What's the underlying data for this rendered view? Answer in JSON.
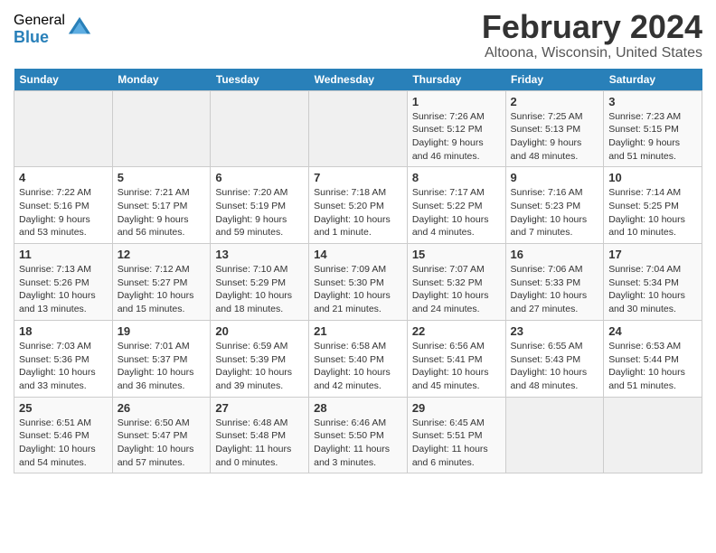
{
  "logo": {
    "general": "General",
    "blue": "Blue"
  },
  "header": {
    "month": "February 2024",
    "location": "Altoona, Wisconsin, United States"
  },
  "weekdays": [
    "Sunday",
    "Monday",
    "Tuesday",
    "Wednesday",
    "Thursday",
    "Friday",
    "Saturday"
  ],
  "weeks": [
    [
      {
        "day": "",
        "info": ""
      },
      {
        "day": "",
        "info": ""
      },
      {
        "day": "",
        "info": ""
      },
      {
        "day": "",
        "info": ""
      },
      {
        "day": "1",
        "info": "Sunrise: 7:26 AM\nSunset: 5:12 PM\nDaylight: 9 hours\nand 46 minutes."
      },
      {
        "day": "2",
        "info": "Sunrise: 7:25 AM\nSunset: 5:13 PM\nDaylight: 9 hours\nand 48 minutes."
      },
      {
        "day": "3",
        "info": "Sunrise: 7:23 AM\nSunset: 5:15 PM\nDaylight: 9 hours\nand 51 minutes."
      }
    ],
    [
      {
        "day": "4",
        "info": "Sunrise: 7:22 AM\nSunset: 5:16 PM\nDaylight: 9 hours\nand 53 minutes."
      },
      {
        "day": "5",
        "info": "Sunrise: 7:21 AM\nSunset: 5:17 PM\nDaylight: 9 hours\nand 56 minutes."
      },
      {
        "day": "6",
        "info": "Sunrise: 7:20 AM\nSunset: 5:19 PM\nDaylight: 9 hours\nand 59 minutes."
      },
      {
        "day": "7",
        "info": "Sunrise: 7:18 AM\nSunset: 5:20 PM\nDaylight: 10 hours\nand 1 minute."
      },
      {
        "day": "8",
        "info": "Sunrise: 7:17 AM\nSunset: 5:22 PM\nDaylight: 10 hours\nand 4 minutes."
      },
      {
        "day": "9",
        "info": "Sunrise: 7:16 AM\nSunset: 5:23 PM\nDaylight: 10 hours\nand 7 minutes."
      },
      {
        "day": "10",
        "info": "Sunrise: 7:14 AM\nSunset: 5:25 PM\nDaylight: 10 hours\nand 10 minutes."
      }
    ],
    [
      {
        "day": "11",
        "info": "Sunrise: 7:13 AM\nSunset: 5:26 PM\nDaylight: 10 hours\nand 13 minutes."
      },
      {
        "day": "12",
        "info": "Sunrise: 7:12 AM\nSunset: 5:27 PM\nDaylight: 10 hours\nand 15 minutes."
      },
      {
        "day": "13",
        "info": "Sunrise: 7:10 AM\nSunset: 5:29 PM\nDaylight: 10 hours\nand 18 minutes."
      },
      {
        "day": "14",
        "info": "Sunrise: 7:09 AM\nSunset: 5:30 PM\nDaylight: 10 hours\nand 21 minutes."
      },
      {
        "day": "15",
        "info": "Sunrise: 7:07 AM\nSunset: 5:32 PM\nDaylight: 10 hours\nand 24 minutes."
      },
      {
        "day": "16",
        "info": "Sunrise: 7:06 AM\nSunset: 5:33 PM\nDaylight: 10 hours\nand 27 minutes."
      },
      {
        "day": "17",
        "info": "Sunrise: 7:04 AM\nSunset: 5:34 PM\nDaylight: 10 hours\nand 30 minutes."
      }
    ],
    [
      {
        "day": "18",
        "info": "Sunrise: 7:03 AM\nSunset: 5:36 PM\nDaylight: 10 hours\nand 33 minutes."
      },
      {
        "day": "19",
        "info": "Sunrise: 7:01 AM\nSunset: 5:37 PM\nDaylight: 10 hours\nand 36 minutes."
      },
      {
        "day": "20",
        "info": "Sunrise: 6:59 AM\nSunset: 5:39 PM\nDaylight: 10 hours\nand 39 minutes."
      },
      {
        "day": "21",
        "info": "Sunrise: 6:58 AM\nSunset: 5:40 PM\nDaylight: 10 hours\nand 42 minutes."
      },
      {
        "day": "22",
        "info": "Sunrise: 6:56 AM\nSunset: 5:41 PM\nDaylight: 10 hours\nand 45 minutes."
      },
      {
        "day": "23",
        "info": "Sunrise: 6:55 AM\nSunset: 5:43 PM\nDaylight: 10 hours\nand 48 minutes."
      },
      {
        "day": "24",
        "info": "Sunrise: 6:53 AM\nSunset: 5:44 PM\nDaylight: 10 hours\nand 51 minutes."
      }
    ],
    [
      {
        "day": "25",
        "info": "Sunrise: 6:51 AM\nSunset: 5:46 PM\nDaylight: 10 hours\nand 54 minutes."
      },
      {
        "day": "26",
        "info": "Sunrise: 6:50 AM\nSunset: 5:47 PM\nDaylight: 10 hours\nand 57 minutes."
      },
      {
        "day": "27",
        "info": "Sunrise: 6:48 AM\nSunset: 5:48 PM\nDaylight: 11 hours\nand 0 minutes."
      },
      {
        "day": "28",
        "info": "Sunrise: 6:46 AM\nSunset: 5:50 PM\nDaylight: 11 hours\nand 3 minutes."
      },
      {
        "day": "29",
        "info": "Sunrise: 6:45 AM\nSunset: 5:51 PM\nDaylight: 11 hours\nand 6 minutes."
      },
      {
        "day": "",
        "info": ""
      },
      {
        "day": "",
        "info": ""
      }
    ]
  ]
}
